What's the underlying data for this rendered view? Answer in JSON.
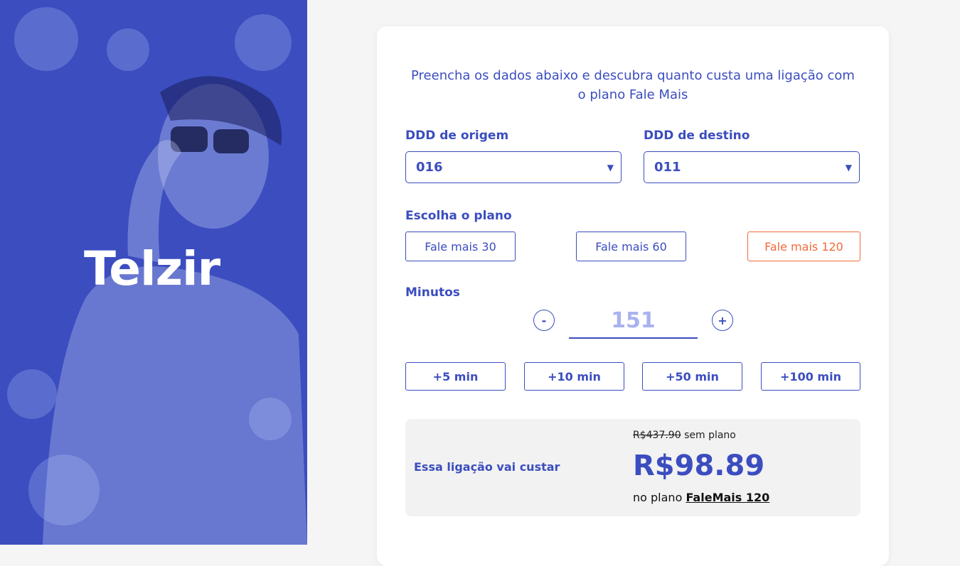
{
  "brand": {
    "name": "Telzir"
  },
  "form": {
    "intro": "Preencha os dados abaixo e descubra quanto custa uma ligação com o plano Fale Mais",
    "origin": {
      "label": "DDD de origem",
      "value": "016"
    },
    "destination": {
      "label": "DDD de destino",
      "value": "011"
    },
    "plan": {
      "label": "Escolha o plano",
      "options": [
        "Fale mais 30",
        "Fale mais 60",
        "Fale mais 120"
      ],
      "selected": "Fale mais 120"
    },
    "minutes": {
      "label": "Minutos",
      "value": "151",
      "decrement": "-",
      "increment": "+",
      "quick_add": [
        "+5 min",
        "+10 min",
        "+50 min",
        "+100 min"
      ]
    }
  },
  "result": {
    "caption": "Essa ligação vai custar",
    "old_price": "R$437.90",
    "old_suffix": " sem plano",
    "price": "R$98.89",
    "plan_prefix": "no plano ",
    "plan_name": "FaleMais 120"
  },
  "colors": {
    "primary": "#3b4dbf",
    "accent": "#f06a3c",
    "muted": "#a9b2f0"
  }
}
